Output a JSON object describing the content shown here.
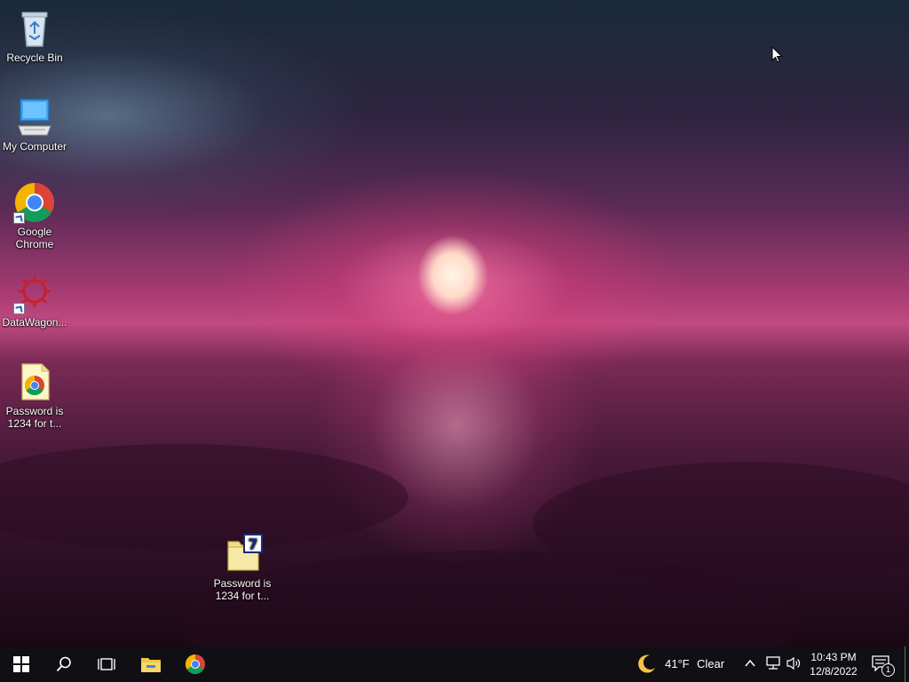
{
  "desktop": {
    "icons": [
      {
        "label": "Recycle Bin"
      },
      {
        "label": "My Computer"
      },
      {
        "label_line1": "Google",
        "label_line2": "Chrome"
      },
      {
        "label": "DataWagon..."
      },
      {
        "label_line1": "Password is",
        "label_line2": "1234 for t..."
      },
      {
        "label_line1": "Password is",
        "label_line2": "1234 for t..."
      }
    ],
    "archive_badge": "7"
  },
  "taskbar": {
    "weather_temp": "41°F",
    "weather_condition": "Clear",
    "time": "10:43 PM",
    "date": "12/8/2022",
    "notification_count": "1"
  },
  "colors": {
    "taskbar_bg": "#101014",
    "accent": "#ffd9c8"
  }
}
